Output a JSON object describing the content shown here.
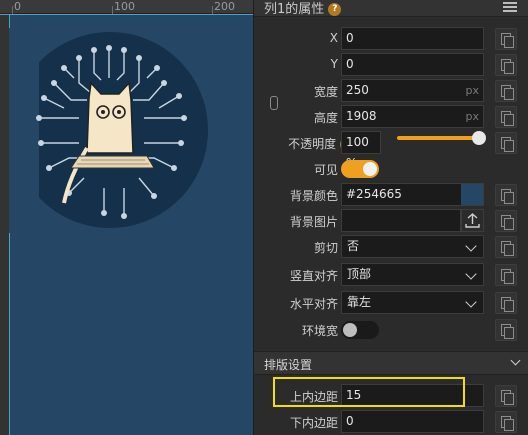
{
  "ruler": {
    "ticks": [
      "0",
      "100",
      "200"
    ]
  },
  "panel": {
    "title": "列1的属性",
    "help_glyph": "?",
    "fields": {
      "x": {
        "label": "X",
        "value": "0"
      },
      "y": {
        "label": "Y",
        "value": "0"
      },
      "width": {
        "label": "宽度",
        "value": "250",
        "unit": "px"
      },
      "height": {
        "label": "高度",
        "value": "1908",
        "unit": "px"
      },
      "opacity": {
        "label": "不透明度",
        "value": "100 %",
        "level": 1.0
      },
      "visible": {
        "label": "可见",
        "on": true
      },
      "bgcolor": {
        "label": "背景颜色",
        "value": "#254665",
        "color": "#254665"
      },
      "bgimage": {
        "label": "背景图片",
        "value": ""
      },
      "clip": {
        "label": "剪切",
        "value": "否"
      },
      "valign": {
        "label": "竖直对齐",
        "value": "顶部"
      },
      "halign": {
        "label": "水平对齐",
        "value": "靠左"
      },
      "wrap": {
        "label": "环境宽",
        "on": false
      }
    },
    "section": {
      "title": "排版设置"
    },
    "layout": {
      "padding_top": {
        "label": "上内边距",
        "value": "15"
      },
      "padding_bottom": {
        "label": "下内边距",
        "value": "0"
      }
    }
  },
  "colors": {
    "accent": "#f0a020",
    "column_bg": "#254665",
    "highlight": "#f2e100"
  }
}
